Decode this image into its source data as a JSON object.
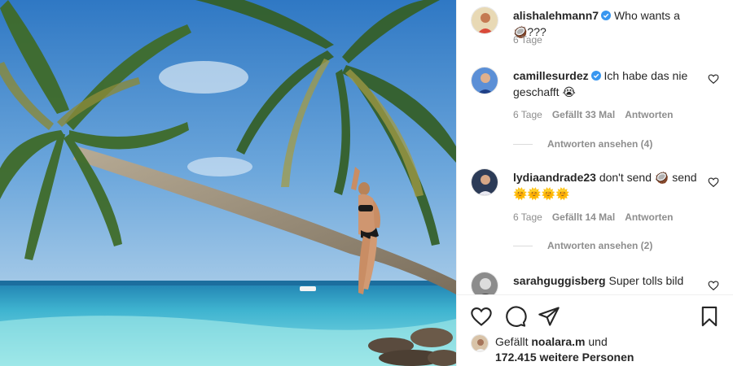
{
  "post": {
    "author": "alishalehmann7",
    "caption": "Who wants a 🥥???",
    "caption_age": "6 Tage"
  },
  "comments": [
    {
      "user": "camillesurdez",
      "verified": true,
      "text": "Ich habe das nie geschafft 😭",
      "age": "6 Tage",
      "likes": "Gefällt 33 Mal",
      "reply_label": "Antworten",
      "view_replies": "Antworten ansehen (4)"
    },
    {
      "user": "lydiaandrade23",
      "verified": false,
      "text": "don't send 🥥 send 🌞🌞🌞🌞",
      "age": "6 Tage",
      "likes": "Gefällt 14 Mal",
      "reply_label": "Antworten",
      "view_replies": "Antworten ansehen (2)"
    },
    {
      "user": "sarahguggisberg",
      "verified": false,
      "text": "Super tolls bild"
    }
  ],
  "likes_summary": {
    "prefix": "Gefällt",
    "user": "noalara.m",
    "conj": "und",
    "count_text": "172.415 weitere Personen"
  },
  "icons": {
    "like": "heart-outline-icon",
    "comment": "speech-bubble-icon",
    "share": "paper-plane-icon",
    "save": "bookmark-icon",
    "verified": "verified-badge-icon"
  },
  "colors": {
    "verified": "#3897f0",
    "muted": "#8e8e8e",
    "text": "#262626"
  }
}
